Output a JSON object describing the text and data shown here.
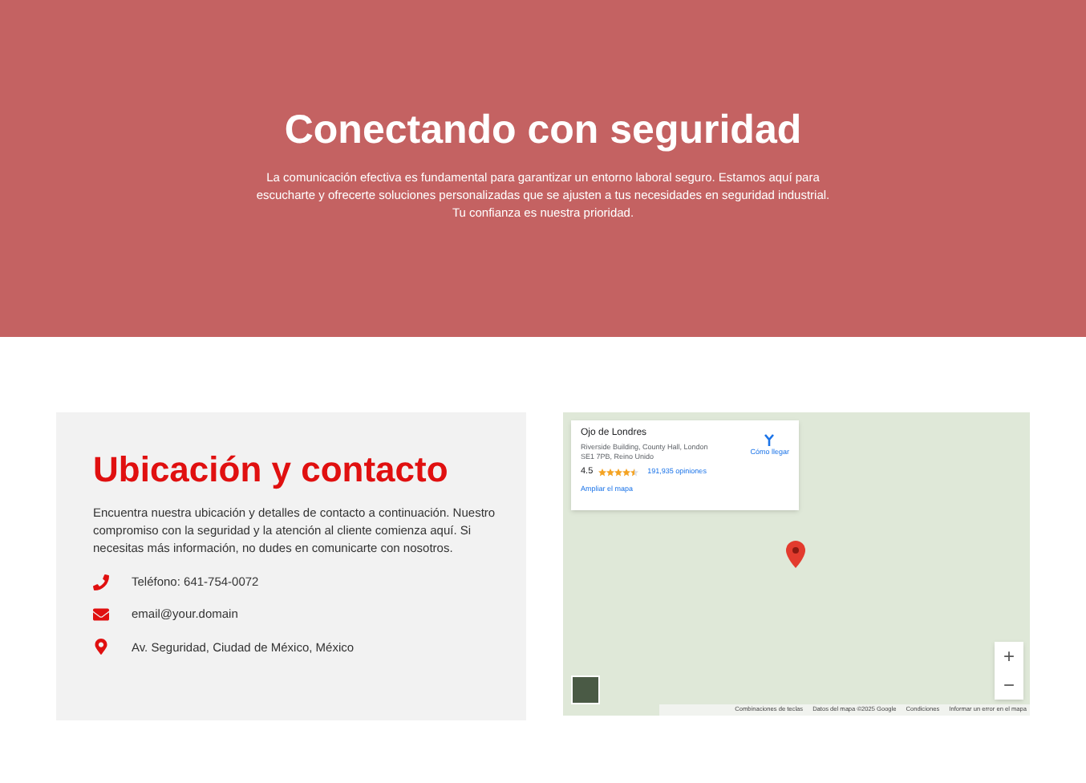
{
  "hero": {
    "title": "Conectando con seguridad",
    "text": "La comunicación efectiva es fundamental para garantizar un entorno laboral seguro. Estamos aquí para escucharte y ofrecerte soluciones personalizadas que se ajusten a tus necesidades en seguridad industrial. Tu confianza es nuestra prioridad."
  },
  "contact": {
    "title": "Ubicación y contacto",
    "text": "Encuentra nuestra ubicación y detalles de contacto a continuación. Nuestro compromiso con la seguridad y la atención al cliente comienza aquí. Si necesitas más información, no dudes en comunicarte con nosotros.",
    "items": [
      {
        "kind": "phone",
        "text": "Teléfono: 641-754-0072"
      },
      {
        "kind": "email",
        "text": "email@your.domain"
      },
      {
        "kind": "location",
        "text": "Av. Seguridad, Ciudad de México, México"
      }
    ]
  },
  "map": {
    "place": {
      "name": "Ojo de Londres",
      "address": "Riverside Building, County Hall, London SE1 7PB, Reino Unido",
      "rating": "4.5",
      "stars": 4.5,
      "reviews": "191,935 opiniones",
      "directions": "Cómo llegar",
      "enlarge": "Ampliar el mapa"
    },
    "zoom": [
      "+",
      "−"
    ],
    "footer": [
      "Combinaciones de teclas",
      "Datos del mapa ©2025 Google",
      "Condiciones",
      "Informar un error en el mapa"
    ]
  }
}
